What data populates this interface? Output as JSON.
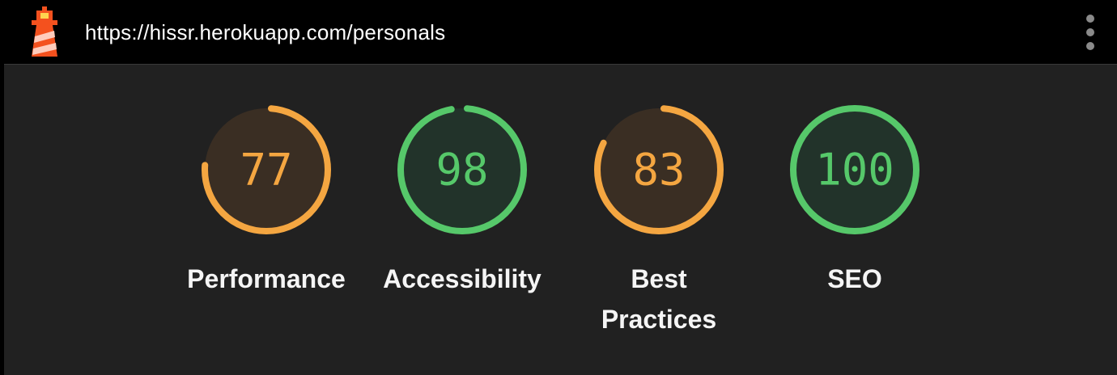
{
  "header": {
    "url": "https://hissr.herokuapp.com/personals",
    "logo_icon": "lighthouse-icon",
    "menu_icon": "more-vert-icon"
  },
  "colors": {
    "average": "#f4a641",
    "average_fill": "#3a2e23",
    "pass": "#56c86a",
    "pass_fill": "#22332a"
  },
  "gauges": [
    {
      "score": 77,
      "label_lines": [
        "Performance"
      ],
      "rating": "average"
    },
    {
      "score": 98,
      "label_lines": [
        "Accessibility"
      ],
      "rating": "pass"
    },
    {
      "score": 83,
      "label_lines": [
        "Best",
        "Practices"
      ],
      "rating": "average"
    },
    {
      "score": 100,
      "label_lines": [
        "SEO"
      ],
      "rating": "pass"
    }
  ]
}
